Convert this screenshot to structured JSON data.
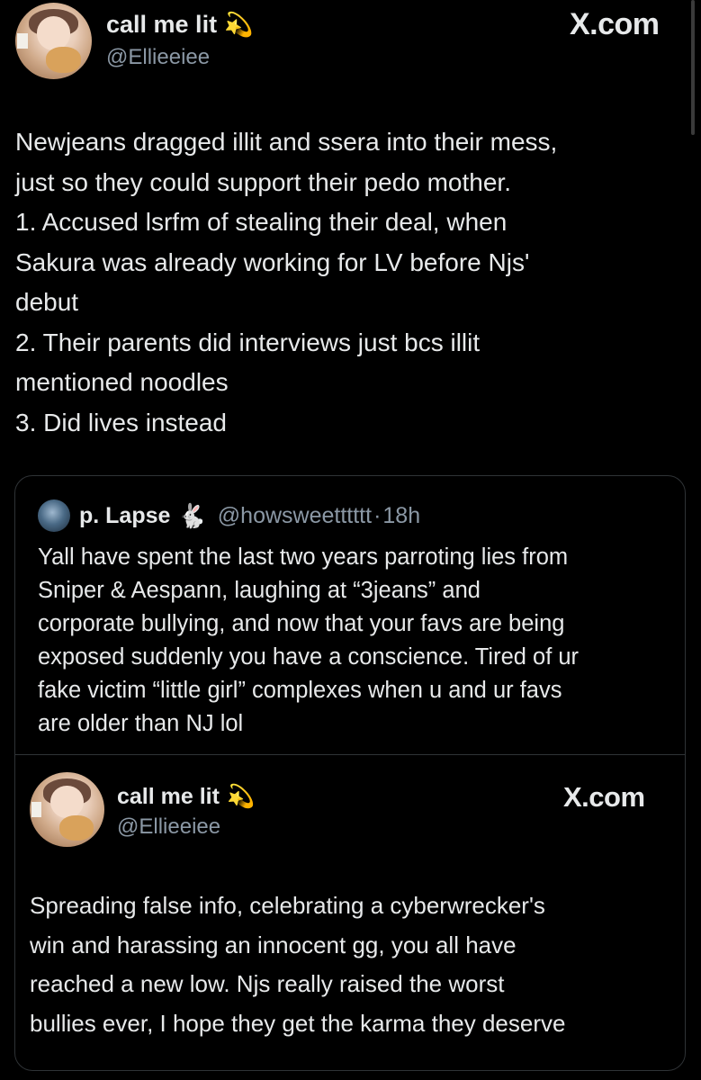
{
  "main_tweet": {
    "author_name": "call me lit",
    "author_emoji": "💫",
    "author_handle": "@Ellieeiee",
    "watermark": "X.com",
    "text": "Newjeans dragged illit and ssera into their mess,\njust so they could support their pedo mother.\n1. Accused lsrfm of stealing their deal, when\nSakura was already working for LV before Njs'\ndebut\n2. Their parents did interviews just bcs illit\nmentioned noodles\n3. Did lives instead"
  },
  "quoted_tweet": {
    "author_name": "p. Lapse",
    "author_emoji": "🐇",
    "author_handle": "@howsweetttttt",
    "separator": "·",
    "time": "18h",
    "text": "Yall have spent the last two years parroting lies from\nSniper & Aespann, laughing at “3jeans” and\ncorporate bullying, and now that your favs are being\nexposed suddenly you have a conscience. Tired of ur\nfake victim “little girl” complexes when u and ur favs\nare older than NJ lol"
  },
  "embedded_tweet": {
    "author_name": "call me lit",
    "author_emoji": "💫",
    "author_handle": "@Ellieeiee",
    "watermark": "X.com",
    "text": "Spreading false info, celebrating a cyberwrecker's\nwin and harassing an innocent gg, you all have\nreached a new low. Njs really raised the worst\nbullies ever, I hope they get the karma they deserve"
  }
}
